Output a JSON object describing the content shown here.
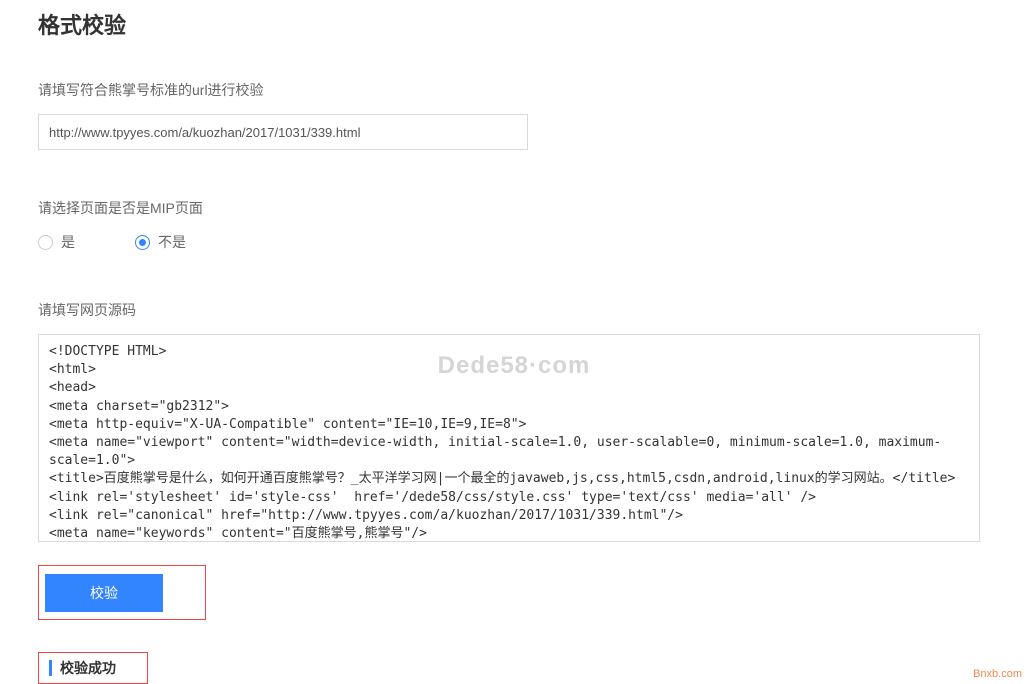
{
  "page_title": "格式校验",
  "url_section": {
    "label": "请填写符合熊掌号标准的url进行校验",
    "value": "http://www.tpyyes.com/a/kuozhan/2017/1031/339.html"
  },
  "mip_section": {
    "label": "请选择页面是否是MIP页面",
    "options": {
      "yes": "是",
      "no": "不是"
    },
    "selected": "no"
  },
  "source_section": {
    "label": "请填写网页源码",
    "content": "<!DOCTYPE HTML>\n<html>\n<head>\n<meta charset=\"gb2312\">\n<meta http-equiv=\"X-UA-Compatible\" content=\"IE=10,IE=9,IE=8\">\n<meta name=\"viewport\" content=\"width=device-width, initial-scale=1.0, user-scalable=0, minimum-scale=1.0, maximum-scale=1.0\">\n<title>百度熊掌号是什么，如何开通百度熊掌号？_太平洋学习网|一个最全的javaweb,js,css,html5,csdn,android,linux的学习网站。</title>\n<link rel='stylesheet' id='style-css'  href='/dede58/css/style.css' type='text/css' media='all' />\n<link rel=\"canonical\" href=\"http://www.tpyyes.com/a/kuozhan/2017/1031/339.html\"/>\n<meta name=\"keywords\" content=\"百度熊掌号,熊掌号\"/>\n<meta name=\"description\" content=\"今天登陆百度站长平台，发现百度站长平台名称变成了百度资源平台，连域名都换了，还出现了\"百度熊掌号\"，"
  },
  "watermark": "Dede58·com",
  "validate_button": "校验",
  "result": "校验成功",
  "footer_mark": "Bnxb.com"
}
